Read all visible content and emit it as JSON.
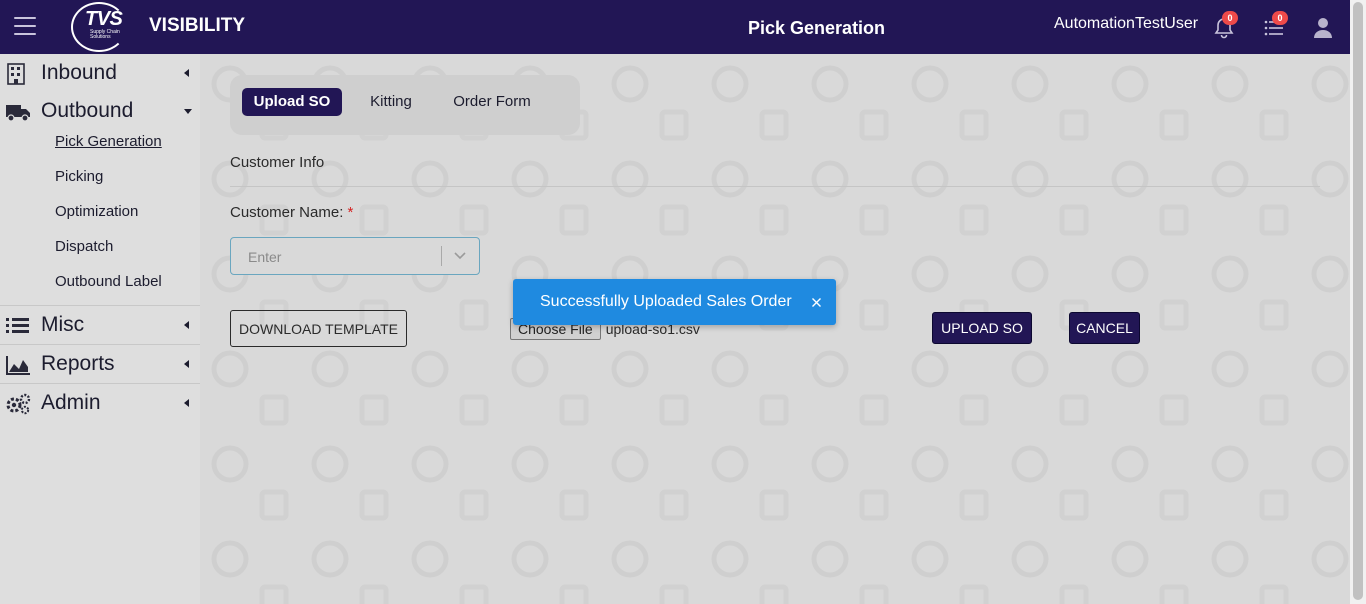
{
  "header": {
    "logo_text": "TVS",
    "logo_subtext": "Supply Chain Solutions",
    "app_name": "VISIBILITY",
    "page_title": "Pick Generation",
    "username": "AutomationTestUser",
    "notifications_count": "0",
    "tasks_count": "0"
  },
  "sidebar": {
    "groups": [
      {
        "label": "Inbound",
        "icon": "building-icon",
        "expanded": false
      },
      {
        "label": "Outbound",
        "icon": "truck-icon",
        "expanded": true,
        "items": [
          "Pick Generation",
          "Picking",
          "Optimization",
          "Dispatch",
          "Outbound Label"
        ],
        "active_item": "Pick Generation"
      },
      {
        "label": "Misc",
        "icon": "list-icon",
        "expanded": false
      },
      {
        "label": "Reports",
        "icon": "area-chart-icon",
        "expanded": false
      },
      {
        "label": "Admin",
        "icon": "gears-icon",
        "expanded": false
      }
    ]
  },
  "main": {
    "tabs": [
      "Upload SO",
      "Kitting",
      "Order Form"
    ],
    "active_tab": "Upload SO",
    "section_title": "Customer Info",
    "customer_label": "Customer Name:",
    "required_mark": "*",
    "customer_placeholder": "Enter",
    "download_template_label": "DOWNLOAD TEMPLATE",
    "choose_file_label": "Choose File",
    "file_name": "upload-so1.csv",
    "upload_label": "UPLOAD SO",
    "cancel_label": "CANCEL"
  },
  "toast": {
    "message": "Successfully Uploaded Sales Order",
    "color": "#1f8ae0"
  },
  "colors": {
    "header_bg": "#221655",
    "primary_button": "#221655",
    "badge": "#ee4a4a"
  }
}
